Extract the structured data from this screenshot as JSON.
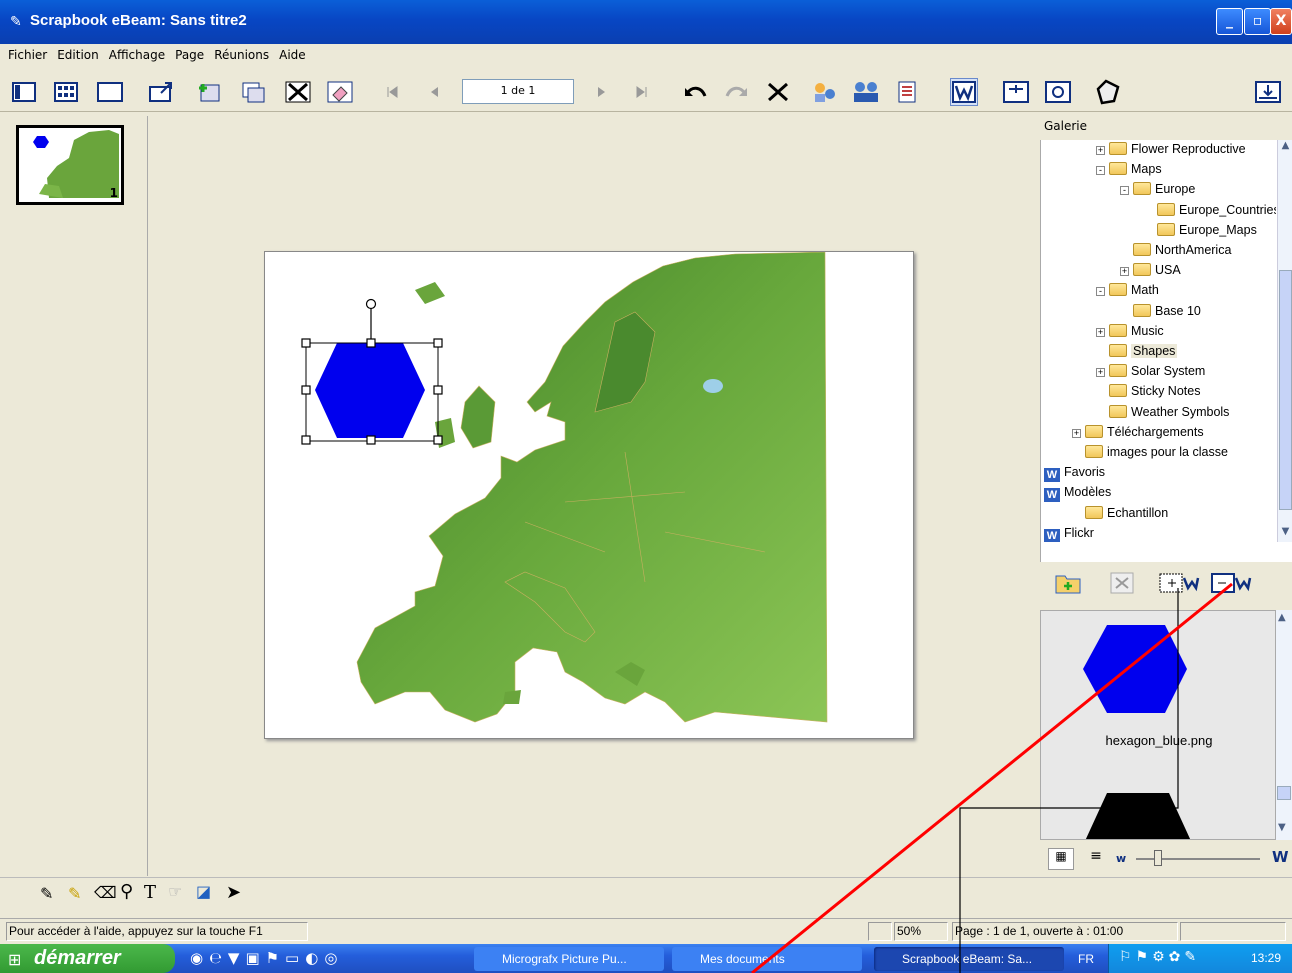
{
  "window": {
    "title": "Scrapbook eBeam: Sans titre2",
    "btn_min": "_",
    "btn_max": "▫",
    "btn_close": "X"
  },
  "menu": [
    "Fichier",
    "Edition",
    "Affichage",
    "Page",
    "Réunions",
    "Aide"
  ],
  "toolbar": {
    "page_field": "1 de 1"
  },
  "thumbnail": {
    "number": "1"
  },
  "galerie": {
    "header": "Galerie",
    "tree": [
      {
        "label": "Flower Reproductive",
        "level": 1,
        "toggle": "+"
      },
      {
        "label": "Maps",
        "level": 1,
        "toggle": "−"
      },
      {
        "label": "Europe",
        "level": 2,
        "toggle": "−"
      },
      {
        "label": "Europe_Countries",
        "level": 3,
        "toggle": ""
      },
      {
        "label": "Europe_Maps",
        "level": 3,
        "toggle": ""
      },
      {
        "label": "NorthAmerica",
        "level": 2,
        "toggle": ""
      },
      {
        "label": "USA",
        "level": 2,
        "toggle": "+"
      },
      {
        "label": "Math",
        "level": 1,
        "toggle": "−"
      },
      {
        "label": "Base 10",
        "level": 2,
        "toggle": ""
      },
      {
        "label": "Music",
        "level": 1,
        "toggle": "+"
      },
      {
        "label": "Shapes",
        "level": 1,
        "toggle": "",
        "selected": true
      },
      {
        "label": "Solar System",
        "level": 1,
        "toggle": "+"
      },
      {
        "label": "Sticky Notes",
        "level": 1,
        "toggle": ""
      },
      {
        "label": "Weather Symbols",
        "level": 1,
        "toggle": ""
      },
      {
        "label": "Téléchargements",
        "level": 0,
        "toggle": "+"
      },
      {
        "label": "images pour la classe",
        "level": 0,
        "toggle": ""
      },
      {
        "label": "Favoris",
        "level": -1,
        "icon": "ebeam"
      },
      {
        "label": "Modèles",
        "level": -1,
        "icon": "ebeam"
      },
      {
        "label": "Echantillon",
        "level": 0,
        "icon": "folder"
      },
      {
        "label": "Flickr",
        "level": -1,
        "icon": "ebeam"
      }
    ],
    "preview_item": "hexagon_blue.png"
  },
  "status": {
    "help": "Pour accéder à l'aide, appuyez sur la touche F1",
    "zoom": "50%",
    "page": "Page : 1 de 1, ouverte à : 01:00"
  },
  "taskbar": {
    "start": "démarrer",
    "tasks": [
      "Micrografx Picture Pu...",
      "Mes documents",
      "Scrapbook eBeam: Sa..."
    ],
    "lang": "FR",
    "clock": "13:29"
  },
  "colors": {
    "hexagon": "#0000ee",
    "map_green": "#6aa53c",
    "annotation": "#ff0000"
  }
}
